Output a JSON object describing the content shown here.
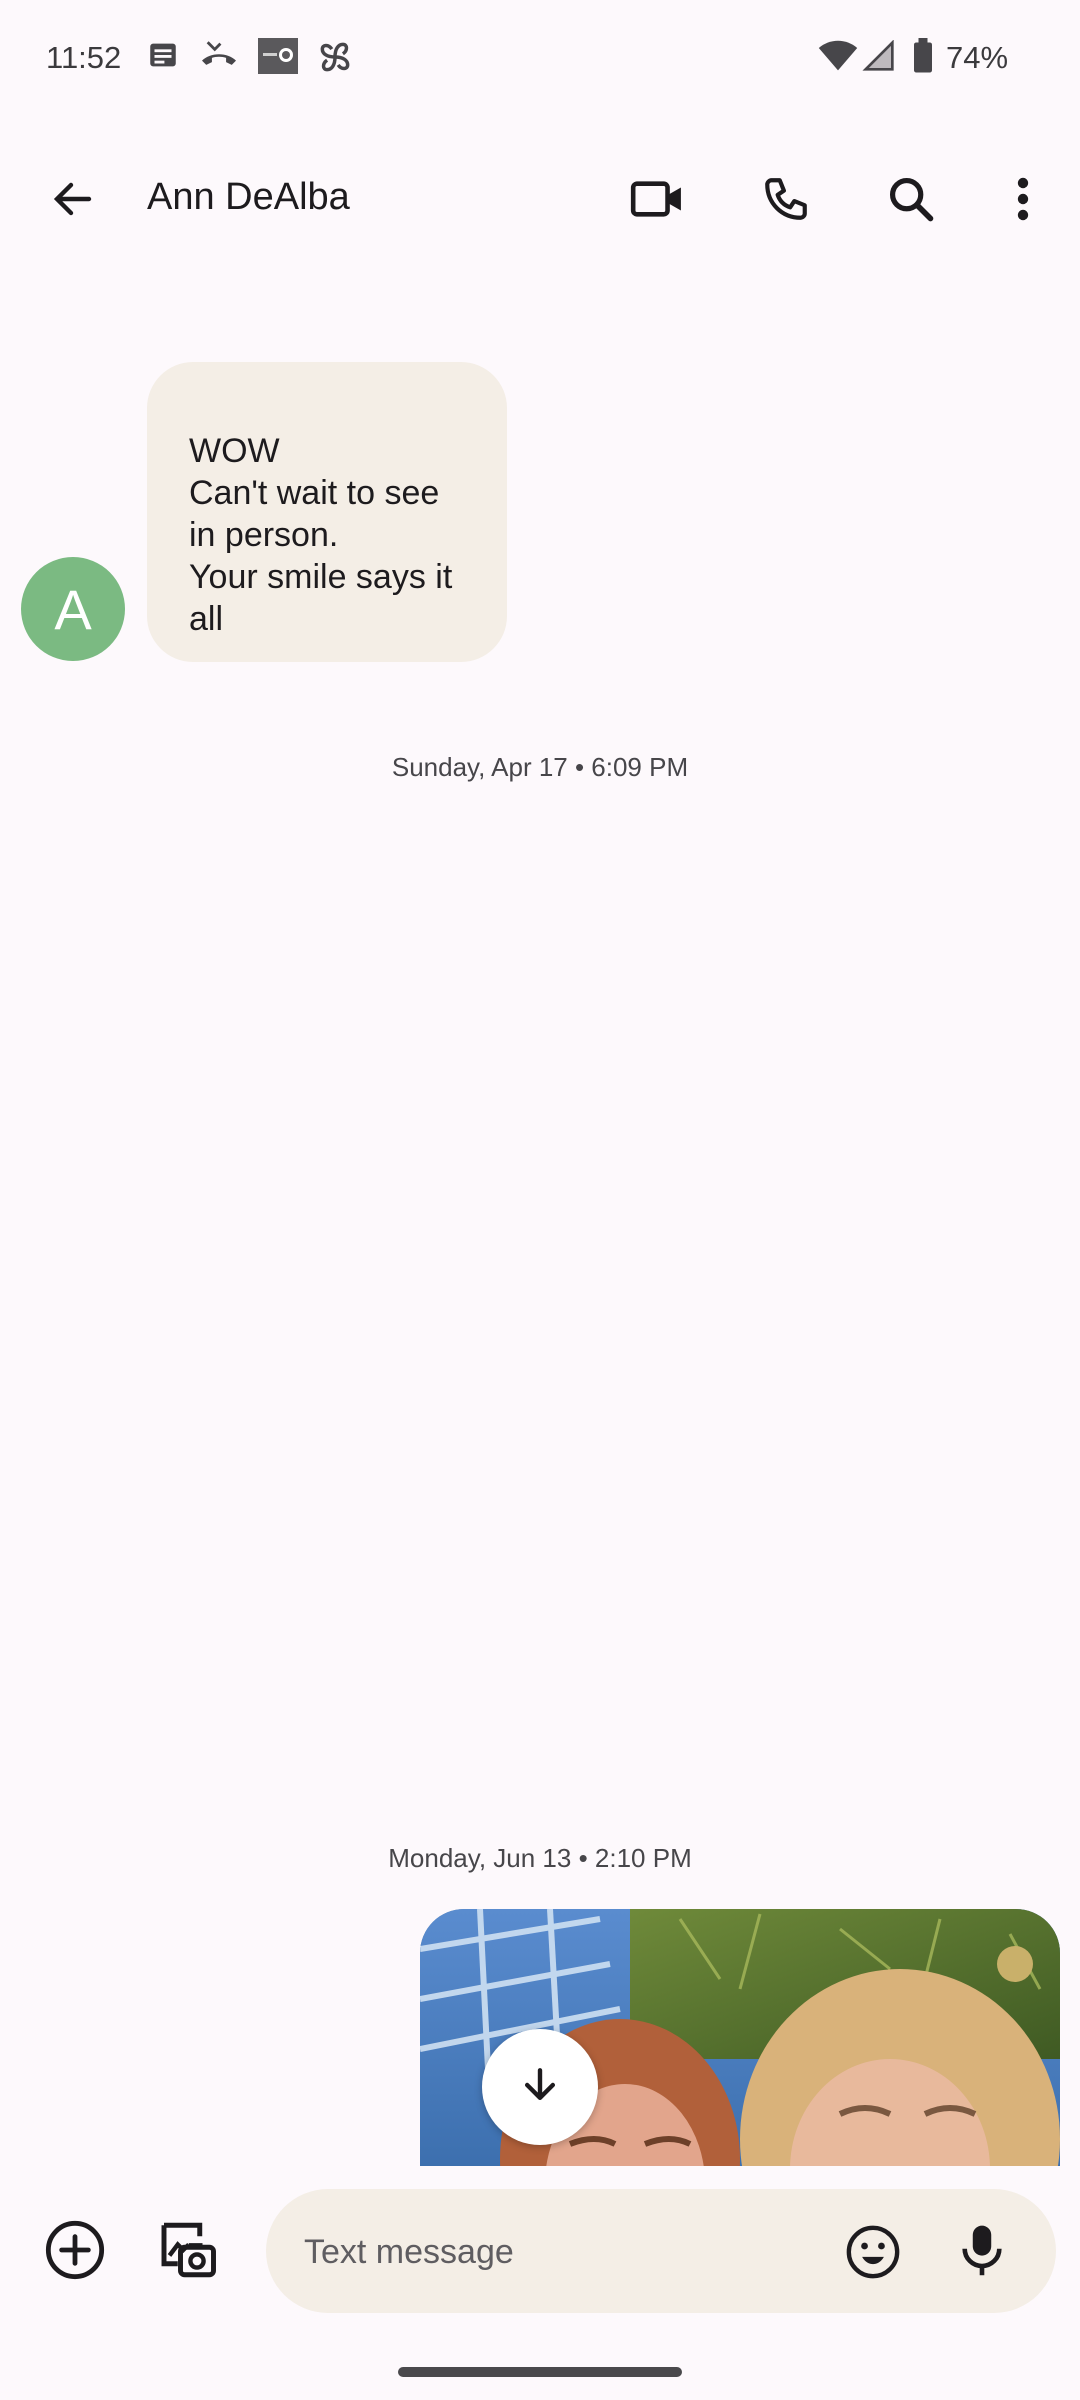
{
  "status_bar": {
    "time": "11:52",
    "battery_percent": "74%",
    "notification_icons": [
      "message-notification-icon",
      "missed-call-icon",
      "myq-icon",
      "pinwheel-icon"
    ],
    "system_icons": [
      "wifi-icon",
      "cell-signal-icon",
      "battery-icon"
    ]
  },
  "app_bar": {
    "contact_name": "Ann DeAlba",
    "actions": [
      "back-arrow-icon",
      "video-call-icon",
      "phone-call-icon",
      "search-icon",
      "more-options-icon"
    ]
  },
  "conversation": {
    "messages": [
      {
        "direction": "incoming",
        "avatar_letter": "A",
        "text": "WOW\nCan't wait to see\nin person.\nYour smile says it\nall"
      }
    ],
    "timestamps": [
      "Sunday, Apr 17 • 6:09 PM",
      "Monday, Jun 13 • 2:10 PM"
    ],
    "outgoing_image": {
      "kind": "photo-attachment"
    }
  },
  "compose": {
    "placeholder": "Text message"
  },
  "colors": {
    "background": "#fdf9fc",
    "bubble": "#f4eee6",
    "avatar": "#7bba82"
  }
}
